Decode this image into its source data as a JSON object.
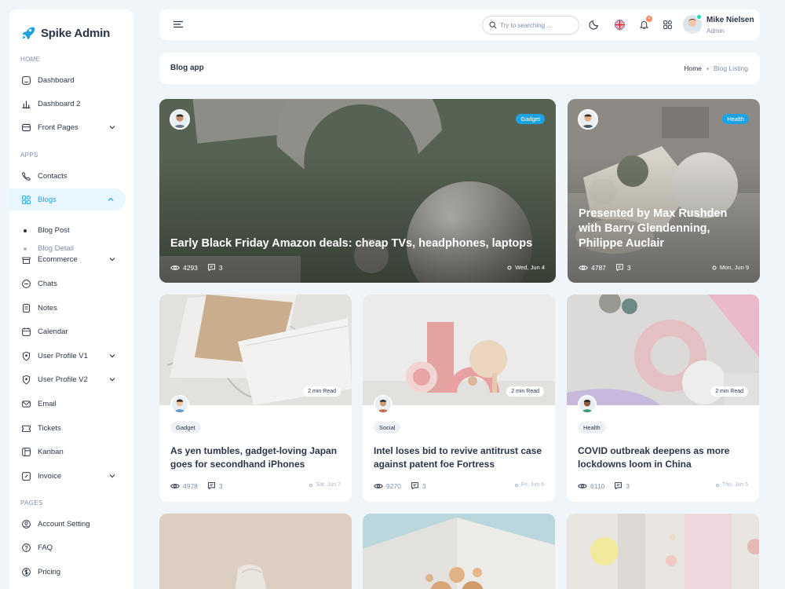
{
  "brand": {
    "name": "Spike Admin"
  },
  "sidebar": {
    "sections": {
      "home": "Home",
      "apps": "Apps",
      "pages": "Pages"
    },
    "items": {
      "dashboard": "Dashboard",
      "dashboard2": "Dashboard 2",
      "front_pages": "Front Pages",
      "contacts": "Contacts",
      "blogs": "Blogs",
      "blog_post": "Blog Post",
      "blog_detail": "Blog Detail",
      "ecommerce": "Ecommerce",
      "chats": "Chats",
      "notes": "Notes",
      "calendar": "Calendar",
      "user_profile_v1": "User Profile V1",
      "user_profile_v2": "User Profile V2",
      "email": "Email",
      "tickets": "Tickets",
      "kanban": "Kanban",
      "invoice": "Invoice",
      "account_setting": "Account Setting",
      "faq": "FAQ",
      "pricing": "Pricing"
    }
  },
  "header": {
    "search_placeholder": "Try to searching ...",
    "notification_count": "4",
    "user_name": "Mike Nielsen",
    "user_role": "Admin"
  },
  "page": {
    "title": "Blog app",
    "breadcrumb_home": "Home",
    "breadcrumb_current": "Blog Listing"
  },
  "featured": [
    {
      "tag": "Gadget",
      "title": "Early Black Friday Amazon deals: cheap TVs, headphones, laptops",
      "views": "4293",
      "comments": "3",
      "date": "Wed, Jun 4"
    },
    {
      "tag": "Health",
      "title": "Presented by Max Rushden with Barry Glendenning, Philippe Auclair",
      "views": "4787",
      "comments": "3",
      "date": "Mon, Jun 9"
    }
  ],
  "posts": [
    {
      "read_time": "2 min Read",
      "tag": "Gadget",
      "title": "As yen tumbles, gadget-loving Japan goes for secondhand iPhones",
      "views": "4978",
      "comments": "3",
      "date": "Sat, Jun 7"
    },
    {
      "read_time": "2 min Read",
      "tag": "Social",
      "title": "Intel loses bid to revive antitrust case against patent foe Fortress",
      "views": "9270",
      "comments": "3",
      "date": "Fri, Jun 6"
    },
    {
      "read_time": "2 min Read",
      "tag": "Health",
      "title": "COVID outbreak deepens as more lockdowns loom in China",
      "views": "6110",
      "comments": "3",
      "date": "Thu, Jun 5"
    }
  ],
  "colors": {
    "accent": "#1da2e4",
    "active_bg": "#e8f7ff",
    "text": "#2a3547",
    "muted": "#7c8fac",
    "background": "#f0f5f9"
  }
}
